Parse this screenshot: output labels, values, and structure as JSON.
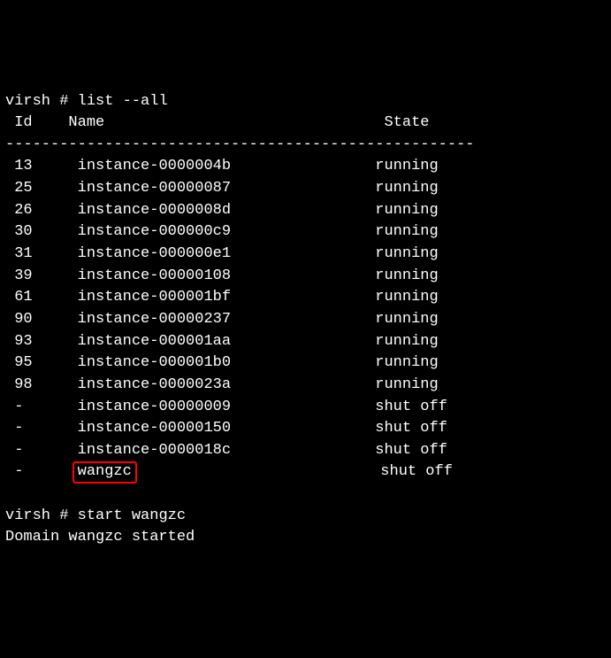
{
  "prompt1": "virsh # ",
  "command1": "list --all",
  "header": {
    "id": " Id",
    "name": "Name",
    "state": "State"
  },
  "separator": "----------------------------------------------------",
  "rows": [
    {
      "id": "13",
      "name": "instance-0000004b",
      "state": "running",
      "highlight": false
    },
    {
      "id": "25",
      "name": "instance-00000087",
      "state": "running",
      "highlight": false
    },
    {
      "id": "26",
      "name": "instance-0000008d",
      "state": "running",
      "highlight": false
    },
    {
      "id": "30",
      "name": "instance-000000c9",
      "state": "running",
      "highlight": false
    },
    {
      "id": "31",
      "name": "instance-000000e1",
      "state": "running",
      "highlight": false
    },
    {
      "id": "39",
      "name": "instance-00000108",
      "state": "running",
      "highlight": false
    },
    {
      "id": "61",
      "name": "instance-000001bf",
      "state": "running",
      "highlight": false
    },
    {
      "id": "90",
      "name": "instance-00000237",
      "state": "running",
      "highlight": false
    },
    {
      "id": "93",
      "name": "instance-000001aa",
      "state": "running",
      "highlight": false
    },
    {
      "id": "95",
      "name": "instance-000001b0",
      "state": "running",
      "highlight": false
    },
    {
      "id": "98",
      "name": "instance-0000023a",
      "state": "running",
      "highlight": false
    },
    {
      "id": "-",
      "name": "instance-00000009",
      "state": "shut off",
      "highlight": false
    },
    {
      "id": "-",
      "name": "instance-00000150",
      "state": "shut off",
      "highlight": false
    },
    {
      "id": "-",
      "name": "instance-0000018c",
      "state": "shut off",
      "highlight": false
    },
    {
      "id": "-",
      "name": "wangzc",
      "state": "shut off",
      "highlight": true
    }
  ],
  "prompt2": "virsh # ",
  "command2": "start wangzc",
  "output2": "Domain wangzc started"
}
